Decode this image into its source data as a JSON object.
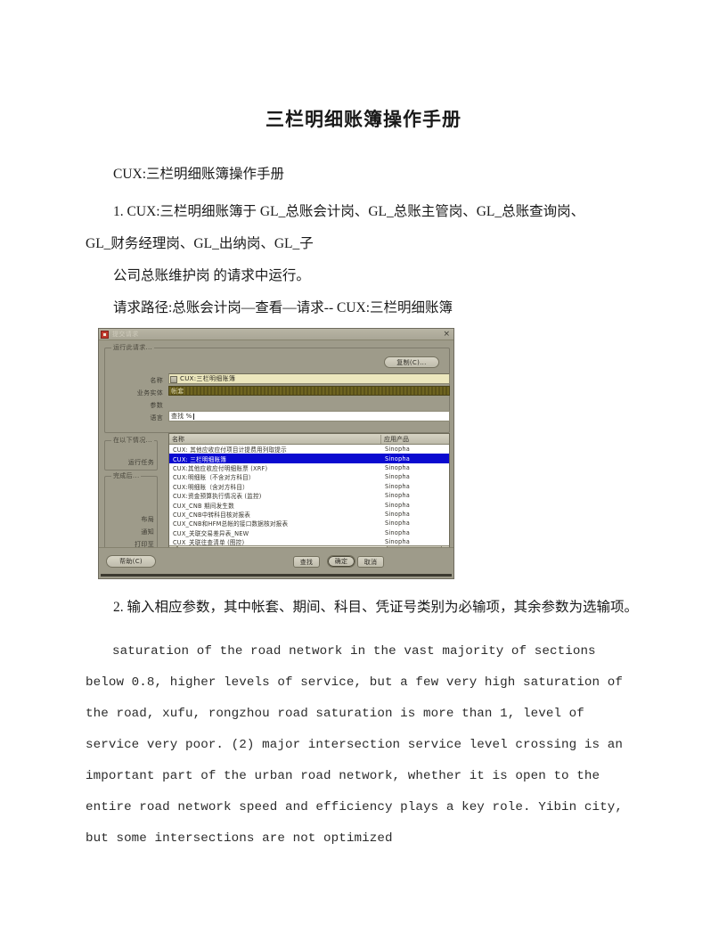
{
  "document": {
    "title": "三栏明细账簿操作手册",
    "subtitle": "CUX:三栏明细账簿操作手册",
    "paragraphs": {
      "item1_line1": "1. CUX:三栏明细账簿于 GL_总账会计岗、GL_总账主管岗、GL_总账查询岗、",
      "item1_line2": "GL_财务经理岗、GL_出纳岗、GL_子",
      "item1_line3": "公司总账维护岗 的请求中运行。",
      "request_path": "请求路径:总账会计岗—查看—请求-- CUX:三栏明细账簿",
      "item2": "2. 输入相应参数，其中帐套、期间、科目、凭证号类别为必输项，其余参数为选输项。"
    },
    "english_paragraph": {
      "line1": "saturation of the road network in the vast majority of sections",
      "line2": "below 0.8, higher levels of service, but a few very high saturation of",
      "line3": "the road, xufu, rongzhou road saturation is more than 1, level of",
      "line4": "service very poor. (2) major intersection service level crossing is an",
      "line5": "important part of the urban road network, whether it is open to the",
      "line6": "entire road network speed and efficiency plays a key role. Yibin city,",
      "line7": "but some intersections are not optimized"
    }
  },
  "embedded_screenshot": {
    "window": {
      "title": "提交请求",
      "close_label": "×"
    },
    "groups": {
      "run_this_request": "运行此请求...",
      "run_when": "在以下情况...",
      "after_completion": "完成后..."
    },
    "labels": {
      "name": "名称",
      "business_entity": "业务实体",
      "parameters": "参数",
      "language": "语言",
      "run_job": "运行任务",
      "layout": "布局",
      "notify": "通知",
      "print_to": "打印至"
    },
    "fields": {
      "copy_button": "复制(C)...",
      "name_value": "CUX:三栏明细账簿",
      "business_entity_value": "帐套",
      "find_label": "查找",
      "find_value": "%"
    },
    "lov": {
      "columns": [
        "名称",
        "应用产品"
      ],
      "rows": [
        {
          "name": "CUX: 其他应收应付项目计提费用列取提示",
          "product": "Sinopha"
        },
        {
          "name": "CUX: 三栏明细账簿",
          "product": "Sinopha",
          "selected": true
        },
        {
          "name": "CUX:其他应收应付明细账票 (XRF)",
          "product": "Sinopha"
        },
        {
          "name": "CUX:明细账（不含对方科目）",
          "product": "Sinopha"
        },
        {
          "name": "CUX:明细账（含对方科目）",
          "product": "Sinopha"
        },
        {
          "name": "CUX:资金预算执行情况表 (监控)",
          "product": "Sinopha"
        },
        {
          "name": "CUX_CNB 期间发生数",
          "product": "Sinopha"
        },
        {
          "name": "CUX_CNB中转科目核对报表",
          "product": "Sinopha"
        },
        {
          "name": "CUX_CNB和HFM总帐的接口数据核对报表",
          "product": "Sinopha"
        },
        {
          "name": "CUX_关联交易差异表_NEW",
          "product": "Sinopha"
        },
        {
          "name": "CUX_关联往查清单 (图控)",
          "product": "Sinopha"
        }
      ],
      "scroll_left_arrow": "◂",
      "scroll_right_arrow": "▸"
    },
    "buttons": {
      "help": "帮助(C)",
      "find": "查找",
      "ok": "确定",
      "cancel": "取消"
    }
  }
}
